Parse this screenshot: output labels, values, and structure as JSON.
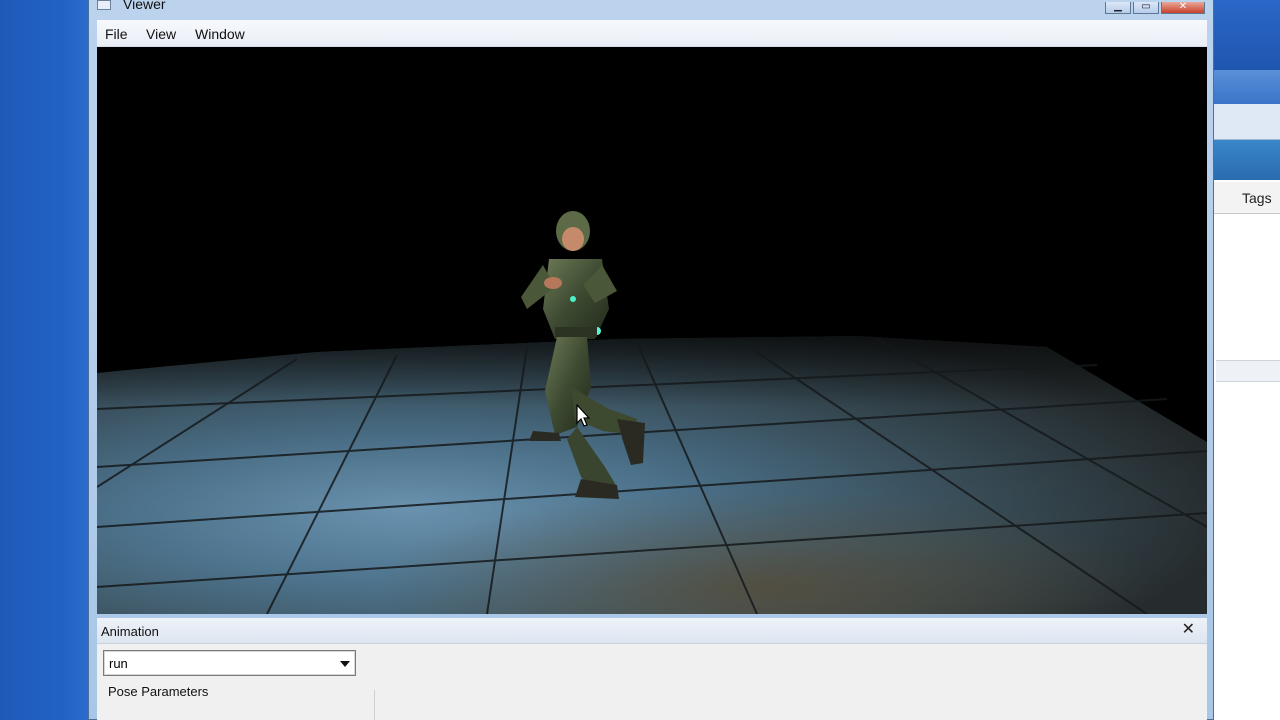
{
  "window": {
    "title": "Viewer",
    "controls": {
      "minimize": "",
      "maximize": "",
      "close": ""
    }
  },
  "menubar": {
    "items": [
      {
        "label": "File"
      },
      {
        "label": "View"
      },
      {
        "label": "Window"
      }
    ]
  },
  "background_window": {
    "tab_label": "Tags"
  },
  "animation_panel": {
    "title": "Animation",
    "close_glyph": "✕",
    "animation_select": {
      "value": "run"
    },
    "pose_parameters_label": "Pose Parameters"
  },
  "colors": {
    "desktop_blue": "#1b56b3",
    "window_chrome": "#bcd3ee",
    "viewport_bg": "#000000",
    "floor_tile": "#4a6f88",
    "close_button": "#c7412b"
  },
  "icons": {
    "window_icon": "app-window-icon",
    "close_panel": "close-icon",
    "dropdown": "chevron-down-icon",
    "cursor": "mouse-pointer-icon"
  }
}
